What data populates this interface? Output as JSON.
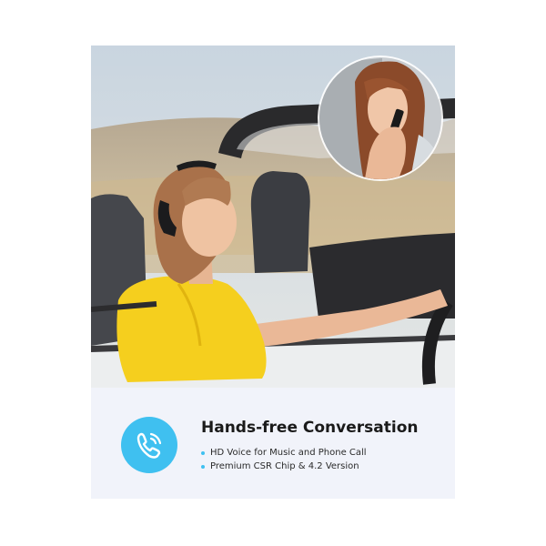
{
  "caption": {
    "headline": "Hands-free Conversation",
    "features": [
      {
        "text": "HD Voice for Music and Phone Call"
      },
      {
        "text": "Premium CSR Chip & 4.2 Version"
      }
    ]
  },
  "icons": {
    "feature_icon": "phone-call-icon",
    "bullet_icon": "bullet-dot-icon"
  },
  "colors": {
    "accent": "#3fc0f0",
    "caption_background": "#f1f3fa",
    "headline_text": "#1a1a1a",
    "feature_text": "#2a2a2a",
    "shirt": "#f5cf1e"
  }
}
